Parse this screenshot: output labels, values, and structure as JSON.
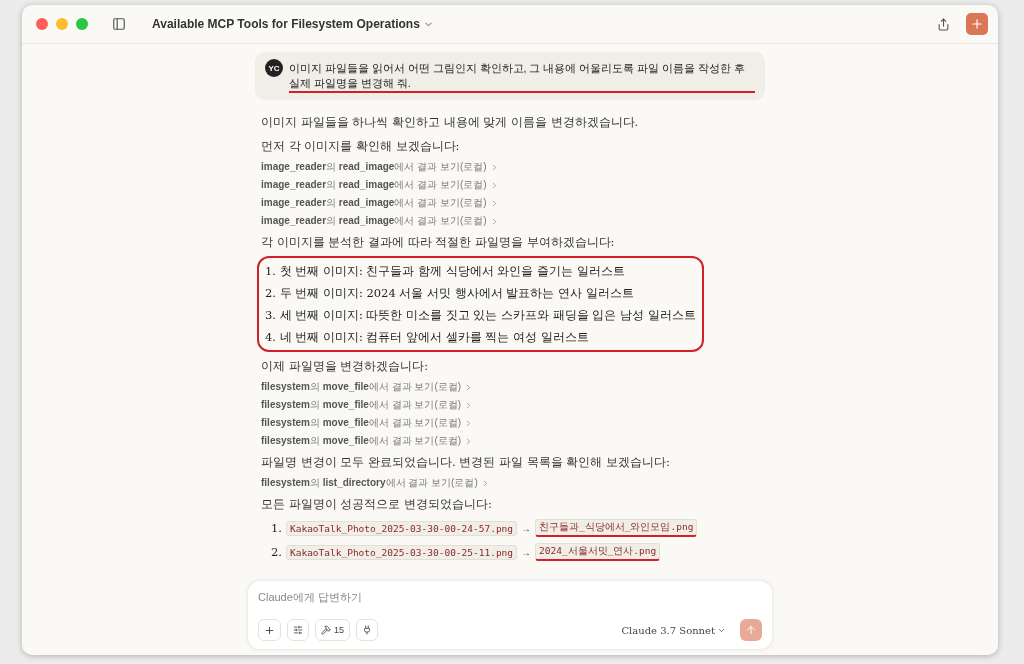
{
  "window": {
    "title": "Available MCP Tools for Filesystem Operations"
  },
  "user_message": {
    "avatar": "YC",
    "text": "이미지 파일들을 읽어서 어떤 그림인지 확인하고, 그 내용에 어울리도록 파일 이름을 작성한 후 실제 파일명을 변경해 줘.",
    "annotated": true
  },
  "blocks": [
    {
      "kind": "paragraph",
      "text": "이미지 파일들을 하나씩 확인하고 내용에 맞게 이름을 변경하겠습니다."
    },
    {
      "kind": "paragraph",
      "text": "먼저 각 이미지를 확인해 보겠습니다:"
    },
    {
      "kind": "tool",
      "text": "**image_reader**의 **read_image**에서 결과 보기(로컬)"
    },
    {
      "kind": "tool",
      "text": "**image_reader**의 **read_image**에서 결과 보기(로컬)"
    },
    {
      "kind": "tool",
      "text": "**image_reader**의 **read_image**에서 결과 보기(로컬)"
    },
    {
      "kind": "tool",
      "text": "**image_reader**의 **read_image**에서 결과 보기(로컬)"
    },
    {
      "kind": "paragraph",
      "text": "각 이미지를 분석한 결과에 따라 적절한 파일명을 부여하겠습니다:"
    },
    {
      "kind": "list",
      "annotated": true,
      "items": [
        {
          "number": "1.",
          "text": "첫 번째 이미지: 친구들과 함께 식당에서 와인을 즐기는 일러스트"
        },
        {
          "number": "2.",
          "text": "두 번째 이미지: 2024 서울 서밋 행사에서 발표하는 연사 일러스트"
        },
        {
          "number": "3.",
          "text": "세 번째 이미지: 따뜻한 미소를 짓고 있는 스카프와 패딩을 입은 남성 일러스트"
        },
        {
          "number": "4.",
          "text": "네 번째 이미지: 컴퓨터 앞에서 셀카를 찍는 여성 일러스트"
        }
      ]
    },
    {
      "kind": "paragraph",
      "text": "이제 파일명을 변경하겠습니다:"
    },
    {
      "kind": "tool",
      "text": "**filesystem**의 **move_file**에서 결과 보기(로컬)"
    },
    {
      "kind": "tool",
      "text": "**filesystem**의 **move_file**에서 결과 보기(로컬)"
    },
    {
      "kind": "tool",
      "text": "**filesystem**의 **move_file**에서 결과 보기(로컬)"
    },
    {
      "kind": "tool",
      "text": "**filesystem**의 **move_file**에서 결과 보기(로컬)"
    },
    {
      "kind": "paragraph",
      "text": "파일명 변경이 모두 완료되었습니다. 변경된 파일 목록을 확인해 보겠습니다:"
    },
    {
      "kind": "tool",
      "text": "**filesystem**의 **list_directory**에서 결과 보기(로컬)"
    },
    {
      "kind": "paragraph",
      "text": "모든 파일명이 성공적으로 변경되었습니다:"
    },
    {
      "kind": "renames",
      "items": [
        {
          "number": "1.",
          "from": "KakaoTalk_Photo_2025-03-30-00-24-57.png",
          "arrow": "→",
          "to": "친구들과_식당에서_와인모임.png",
          "annotated": true
        },
        {
          "number": "2.",
          "from": "KakaoTalk_Photo_2025-03-30-00-25-11.png",
          "arrow": "→",
          "to": "2024_서울서밋_연사.png",
          "annotated": true
        }
      ]
    }
  ],
  "composer": {
    "placeholder": "Claude에게 답변하기",
    "tools_count": "15",
    "model": "Claude 3.7 Sonnet"
  }
}
